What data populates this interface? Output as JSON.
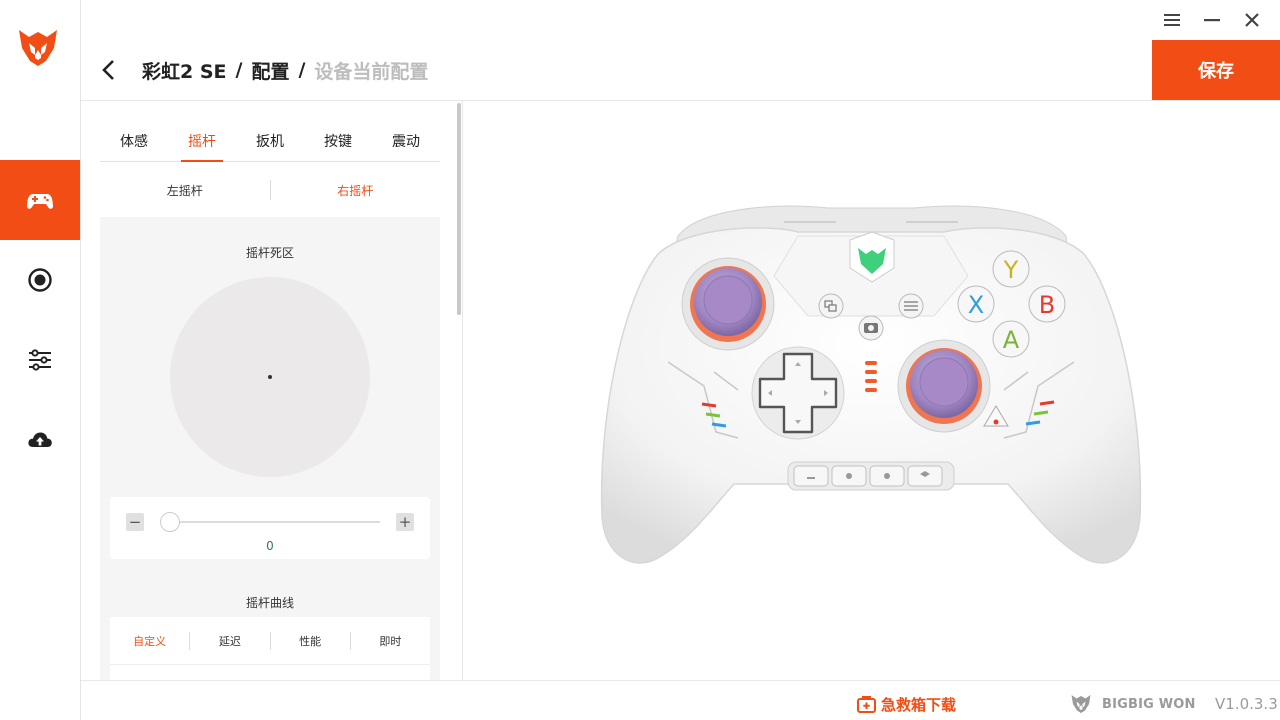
{
  "window": {
    "menu_icon": "menu-icon",
    "minimize_icon": "minimize-icon",
    "close_icon": "close-icon"
  },
  "sidebar": {
    "accent": "#f24d14",
    "items": [
      {
        "name": "controller",
        "icon": "gamepad-icon",
        "active": true
      },
      {
        "name": "record",
        "icon": "record-icon",
        "active": false
      },
      {
        "name": "adjust",
        "icon": "sliders-icon",
        "active": false
      },
      {
        "name": "upload",
        "icon": "cloud-upload-icon",
        "active": false
      }
    ]
  },
  "header": {
    "breadcrumb": [
      "彩虹2 SE",
      "配置",
      "设备当前配置"
    ],
    "separator": "/",
    "save_label": "保存"
  },
  "panel": {
    "tabs": [
      "体感",
      "摇杆",
      "扳机",
      "按键",
      "震动"
    ],
    "active_tab": 1,
    "subtabs": [
      "左摇杆",
      "右摇杆"
    ],
    "active_subtab": 1,
    "deadzone": {
      "title": "摇杆死区",
      "minus": "−",
      "plus": "+",
      "value": "0",
      "slider_fraction": 0
    },
    "curve": {
      "title": "摇杆曲线",
      "options": [
        "自定义",
        "延迟",
        "性能",
        "即时"
      ],
      "active": 0
    }
  },
  "controller": {
    "buttons": {
      "y": "Y",
      "x": "X",
      "b": "B",
      "a": "A"
    },
    "colors": {
      "y": "#c9b21e",
      "x": "#2f9de0",
      "b": "#e63a2c",
      "a": "#7ab33a",
      "accent_glow": "#f15a2b",
      "stick": "#a98fc9",
      "logo": "#3ed07a"
    }
  },
  "footer": {
    "rescue_label": "急救箱下载",
    "brand": "BIGBIG WON",
    "version": "V1.0.3.3"
  }
}
